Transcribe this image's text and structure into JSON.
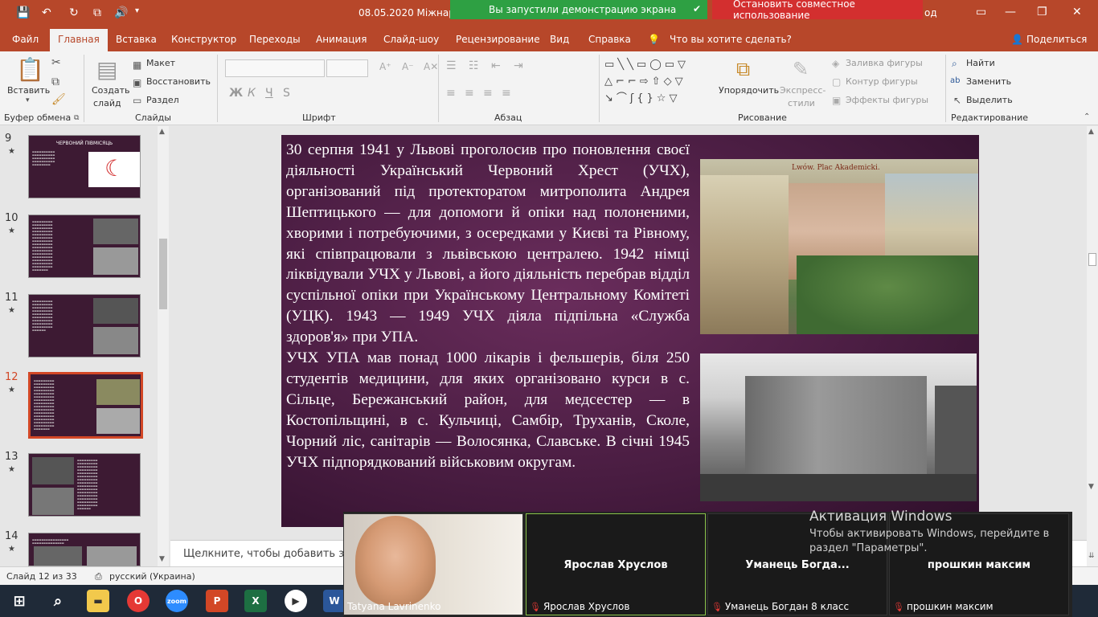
{
  "titlebar": {
    "title": "08.05.2020 Міжнаро",
    "account_fragment": "од"
  },
  "share": {
    "green_text": "Вы запустили демонстрацию экрана",
    "red_text": "Остановить совместное использование"
  },
  "menu": [
    "Файл",
    "Главная",
    "Вставка",
    "Конструктор",
    "Переходы",
    "Анимация",
    "Слайд-шоу",
    "Рецензирование",
    "Вид",
    "Справка",
    "Что вы хотите сделать?"
  ],
  "menu_share": "Поделиться",
  "ribbon": {
    "paste": "Вставить",
    "new_slide_1": "Создать",
    "new_slide_2": "слайд",
    "layout": "Макет",
    "reset": "Восстановить",
    "section": "Раздел",
    "arrange": "Упорядочить",
    "quick_styles_1": "Экспресс-",
    "quick_styles_2": "стили",
    "shape_fill": "Заливка фигуры",
    "shape_outline": "Контур фигуры",
    "shape_effects": "Эффекты фигуры",
    "find": "Найти",
    "replace": "Заменить",
    "select": "Выделить",
    "groups": {
      "clipboard": "Буфер обмена",
      "slides": "Слайды",
      "font": "Шрифт",
      "paragraph": "Абзац",
      "drawing": "Рисование",
      "editing": "Редактирование"
    },
    "font_bold": "Ж",
    "font_italic": "К",
    "font_underline": "Ч",
    "font_strike": "S"
  },
  "thumbnails": [
    {
      "num": "9",
      "title": "ЧЕРВОНИЙ ПІВМІСЯЦЬ"
    },
    {
      "num": "10"
    },
    {
      "num": "11"
    },
    {
      "num": "12"
    },
    {
      "num": "13"
    },
    {
      "num": "14"
    }
  ],
  "slide": {
    "text": "30 серпня 1941 у Львові проголосив про поновлення своєї діяльності Український Червоний Хрест (УЧХ), організований під протекторатом митрополита Андрея Шептицького  — для допомоги й опіки над полоненими, хворими і потребуючими, з осередками у Києві та Рівному, які співпрацювали з львівською централею. 1942 німці ліквідували УЧХ у Львові, а його діяльність перебрав відділ суспільної опіки при Українському Центральному Комітеті (УЦК). 1943 — 1949 УЧХ діяла підпільна «Служба здоров'я» при УПА.",
    "text2": "УЧХ УПА мав понад 1000 лікарів і фельшерів, біля 250 студентів медицини, для яких організовано курси в с. Сільце, Бережанський район, для медсестер — в Костопільщині, в с. Кульчиці, Самбір, Труханів, Сколе, Чорний ліс, санітарів — Волосянка, Славське. В січні 1945 УЧХ підпорядкований військовим округам.",
    "photo1_caption": "Lwów. Plac Akademicki."
  },
  "notes_placeholder": "Щелкните, чтобы добавить за",
  "status": {
    "slide": "Слайд 12 из 33",
    "language": "русский (Украина)"
  },
  "zoom": {
    "tiles": [
      {
        "label": "Tatyana Lavrinenko"
      },
      {
        "name": "Ярослав Хруслов",
        "label": "Ярослав Хруслов"
      },
      {
        "name": "Уманець  Богда...",
        "label": "Уманець Богдан 8 класс"
      },
      {
        "name": "прошкин максим",
        "label": "прошкин максим"
      }
    ]
  },
  "activation": {
    "title": "Активация Windows",
    "line1": "Чтобы активировать Windows, перейдите в",
    "line2": "раздел \"Параметры\"."
  }
}
